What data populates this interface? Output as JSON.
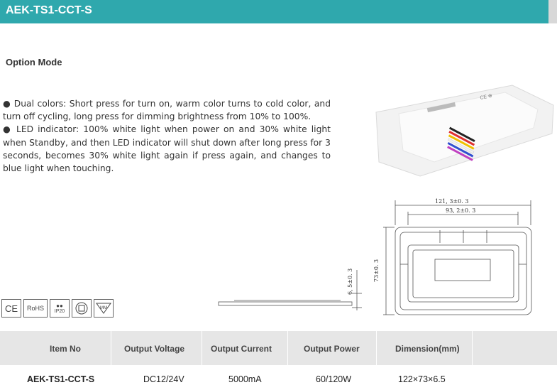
{
  "header": {
    "title": "AEK-TS1-CCT-S"
  },
  "section": {
    "title": "Option Mode"
  },
  "description": [
    "● Dual colors: Short press for turn on, warm color turns to cold color, and turn off cycling, long press for dimming brightness from 10% to 100%.",
    "● LED indicator: 100% white light when power on and 30% white light when Standby, and then LED indicator will shut down after long press for 3 seconds, becomes 30% white light again if press again, and changes to blue light when touching."
  ],
  "drawing": {
    "width_outer": "121, 3±0. 3",
    "width_inner": "93, 2±0. 3",
    "height": "73±0. 3",
    "thickness": "6, 5±0. 3"
  },
  "certifications": [
    "CE",
    "RoHS",
    "IP20",
    "class-II",
    "MM"
  ],
  "table": {
    "headers": [
      "Item No",
      "Output Voltage",
      "Output Current",
      "Output Power",
      "Dimension(mm)"
    ],
    "row": [
      "AEK-TS1-CCT-S",
      "DC12/24V",
      "5000mA",
      "60/120W",
      "122×73×6.5"
    ]
  }
}
